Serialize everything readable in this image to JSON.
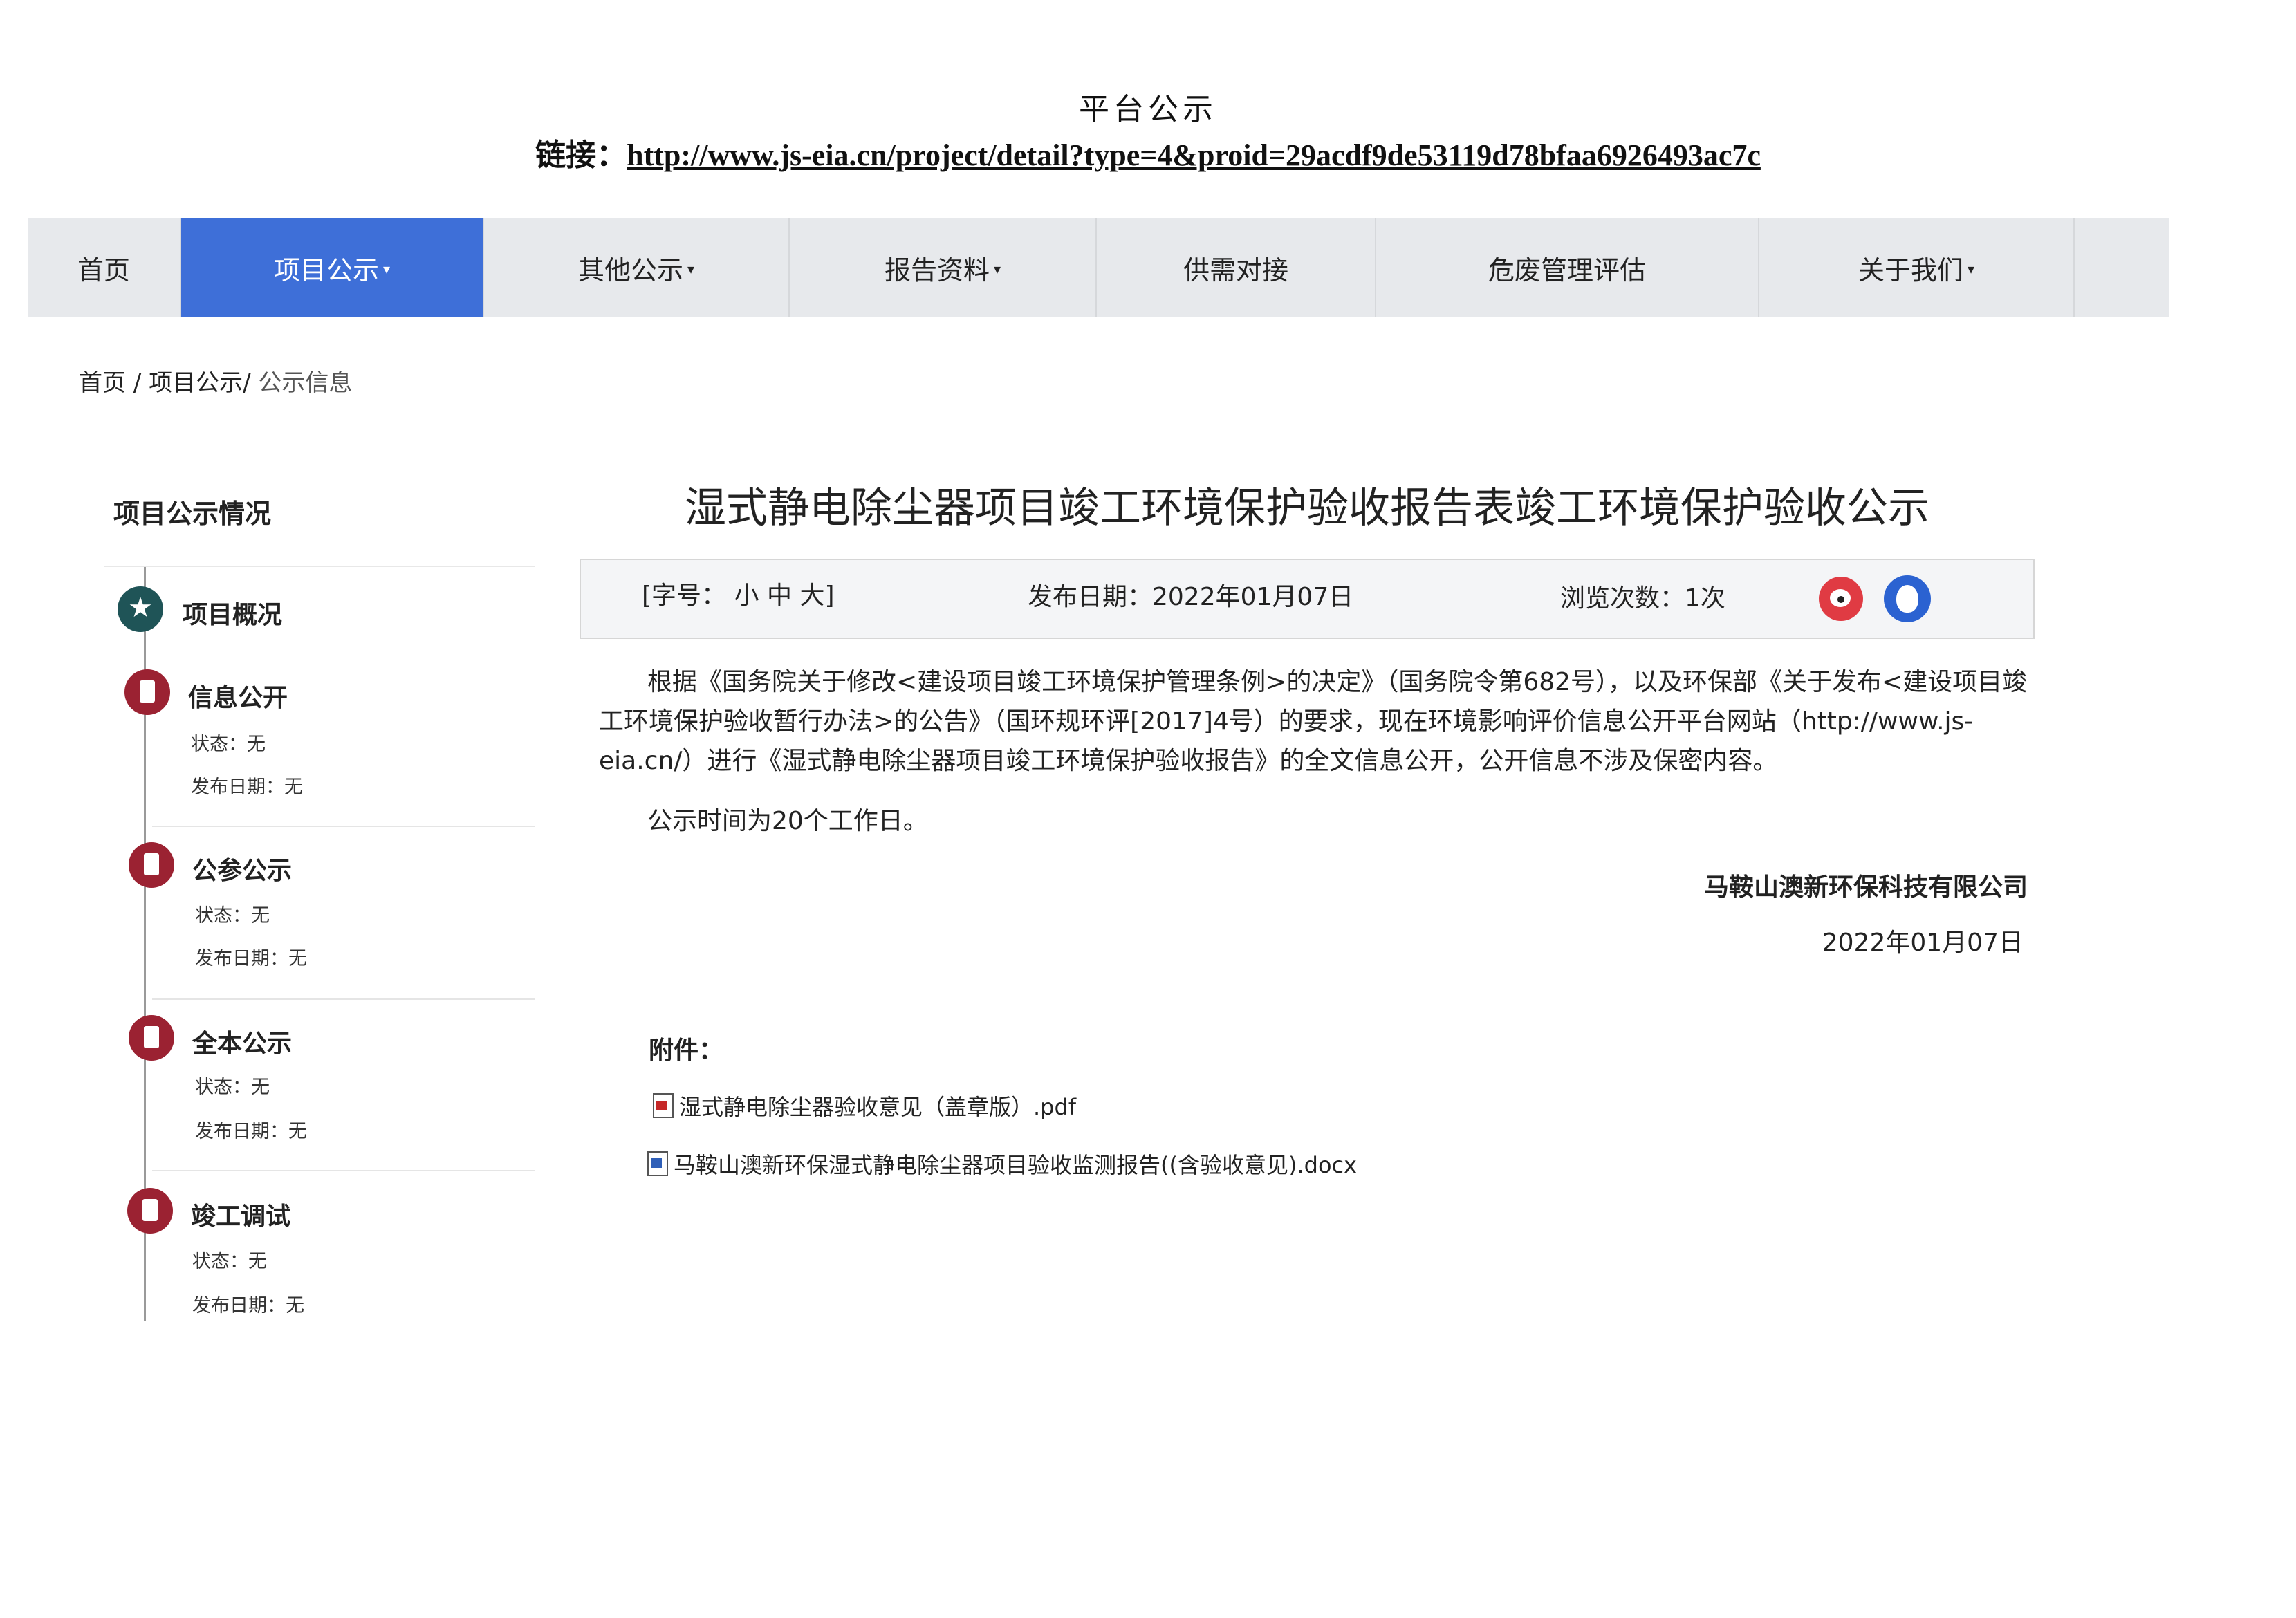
{
  "header": {
    "title": "平台公示",
    "link_label": "链接：",
    "link_url": "http://www.js-eia.cn/project/detail?type=4&proid=29acdf9de53119d78bfaa6926493ac7c"
  },
  "nav": {
    "items": [
      {
        "label": "首页",
        "dropdown": false
      },
      {
        "label": "项目公示",
        "dropdown": true,
        "active": true
      },
      {
        "label": "其他公示",
        "dropdown": true
      },
      {
        "label": "报告资料",
        "dropdown": true
      },
      {
        "label": "供需对接",
        "dropdown": false
      },
      {
        "label": "危废管理评估",
        "dropdown": false
      },
      {
        "label": "关于我们",
        "dropdown": true
      }
    ],
    "caret": "▾"
  },
  "breadcrumb": {
    "home": "首页",
    "sep1": " / ",
    "section": "项目公示",
    "sep2": "/ ",
    "current": "公示信息"
  },
  "sidebar": {
    "title": "项目公示情况",
    "items": [
      {
        "name": "项目概况",
        "icon": "star-icon"
      },
      {
        "name": "信息公开",
        "icon": "document-icon",
        "status": "状态：无",
        "date": "发布日期：无"
      },
      {
        "name": "公参公示",
        "icon": "document-icon",
        "status": "状态：无",
        "date": "发布日期：无"
      },
      {
        "name": "全本公示",
        "icon": "document-icon",
        "status": "状态：无",
        "date": "发布日期：无"
      },
      {
        "name": "竣工调试",
        "icon": "document-icon",
        "status": "状态：无",
        "date": "发布日期：无"
      }
    ]
  },
  "article": {
    "title": "湿式静电除尘器项目竣工环境保护验收报告表竣工环境保护验收公示",
    "font_size_label": "[字号：",
    "font_sizes": [
      "小",
      "中",
      "大"
    ],
    "font_size_close": "]",
    "publish_date": "发布日期：2022年01月07日",
    "views": "浏览次数：1次",
    "body": "根据《国务院关于修改<建设项目竣工环境保护管理条例>的决定》（国务院令第682号），以及环保部《关于发布<建设项目竣工环境保护验收暂行办法>的公告》（国环规环评[2017]4号）的要求，现在环境影响评价信息公开平台网站（http://www.js-eia.cn/）进行《湿式静电除尘器项目竣工环境保护验收报告》的全文信息公开，公开信息不涉及保密内容。",
    "period": "公示时间为20个工作日。",
    "signature_company": "马鞍山澳新环保科技有限公司",
    "signature_date": "2022年01月07日",
    "attachments_label": "附件：",
    "attachments": [
      {
        "name": "湿式静电除尘器验收意见（盖章版）.pdf",
        "icon": "pdf-file-icon"
      },
      {
        "name": "马鞍山澳新环保湿式静电除尘器项目验收监测报告((含验收意见).docx",
        "icon": "word-file-icon"
      }
    ]
  },
  "colors": {
    "nav_active": "#3e6fd8",
    "timeline_doc": "#9b2232",
    "timeline_star": "#1f5457",
    "weibo": "#e03b43",
    "qq": "#2b62d1"
  }
}
